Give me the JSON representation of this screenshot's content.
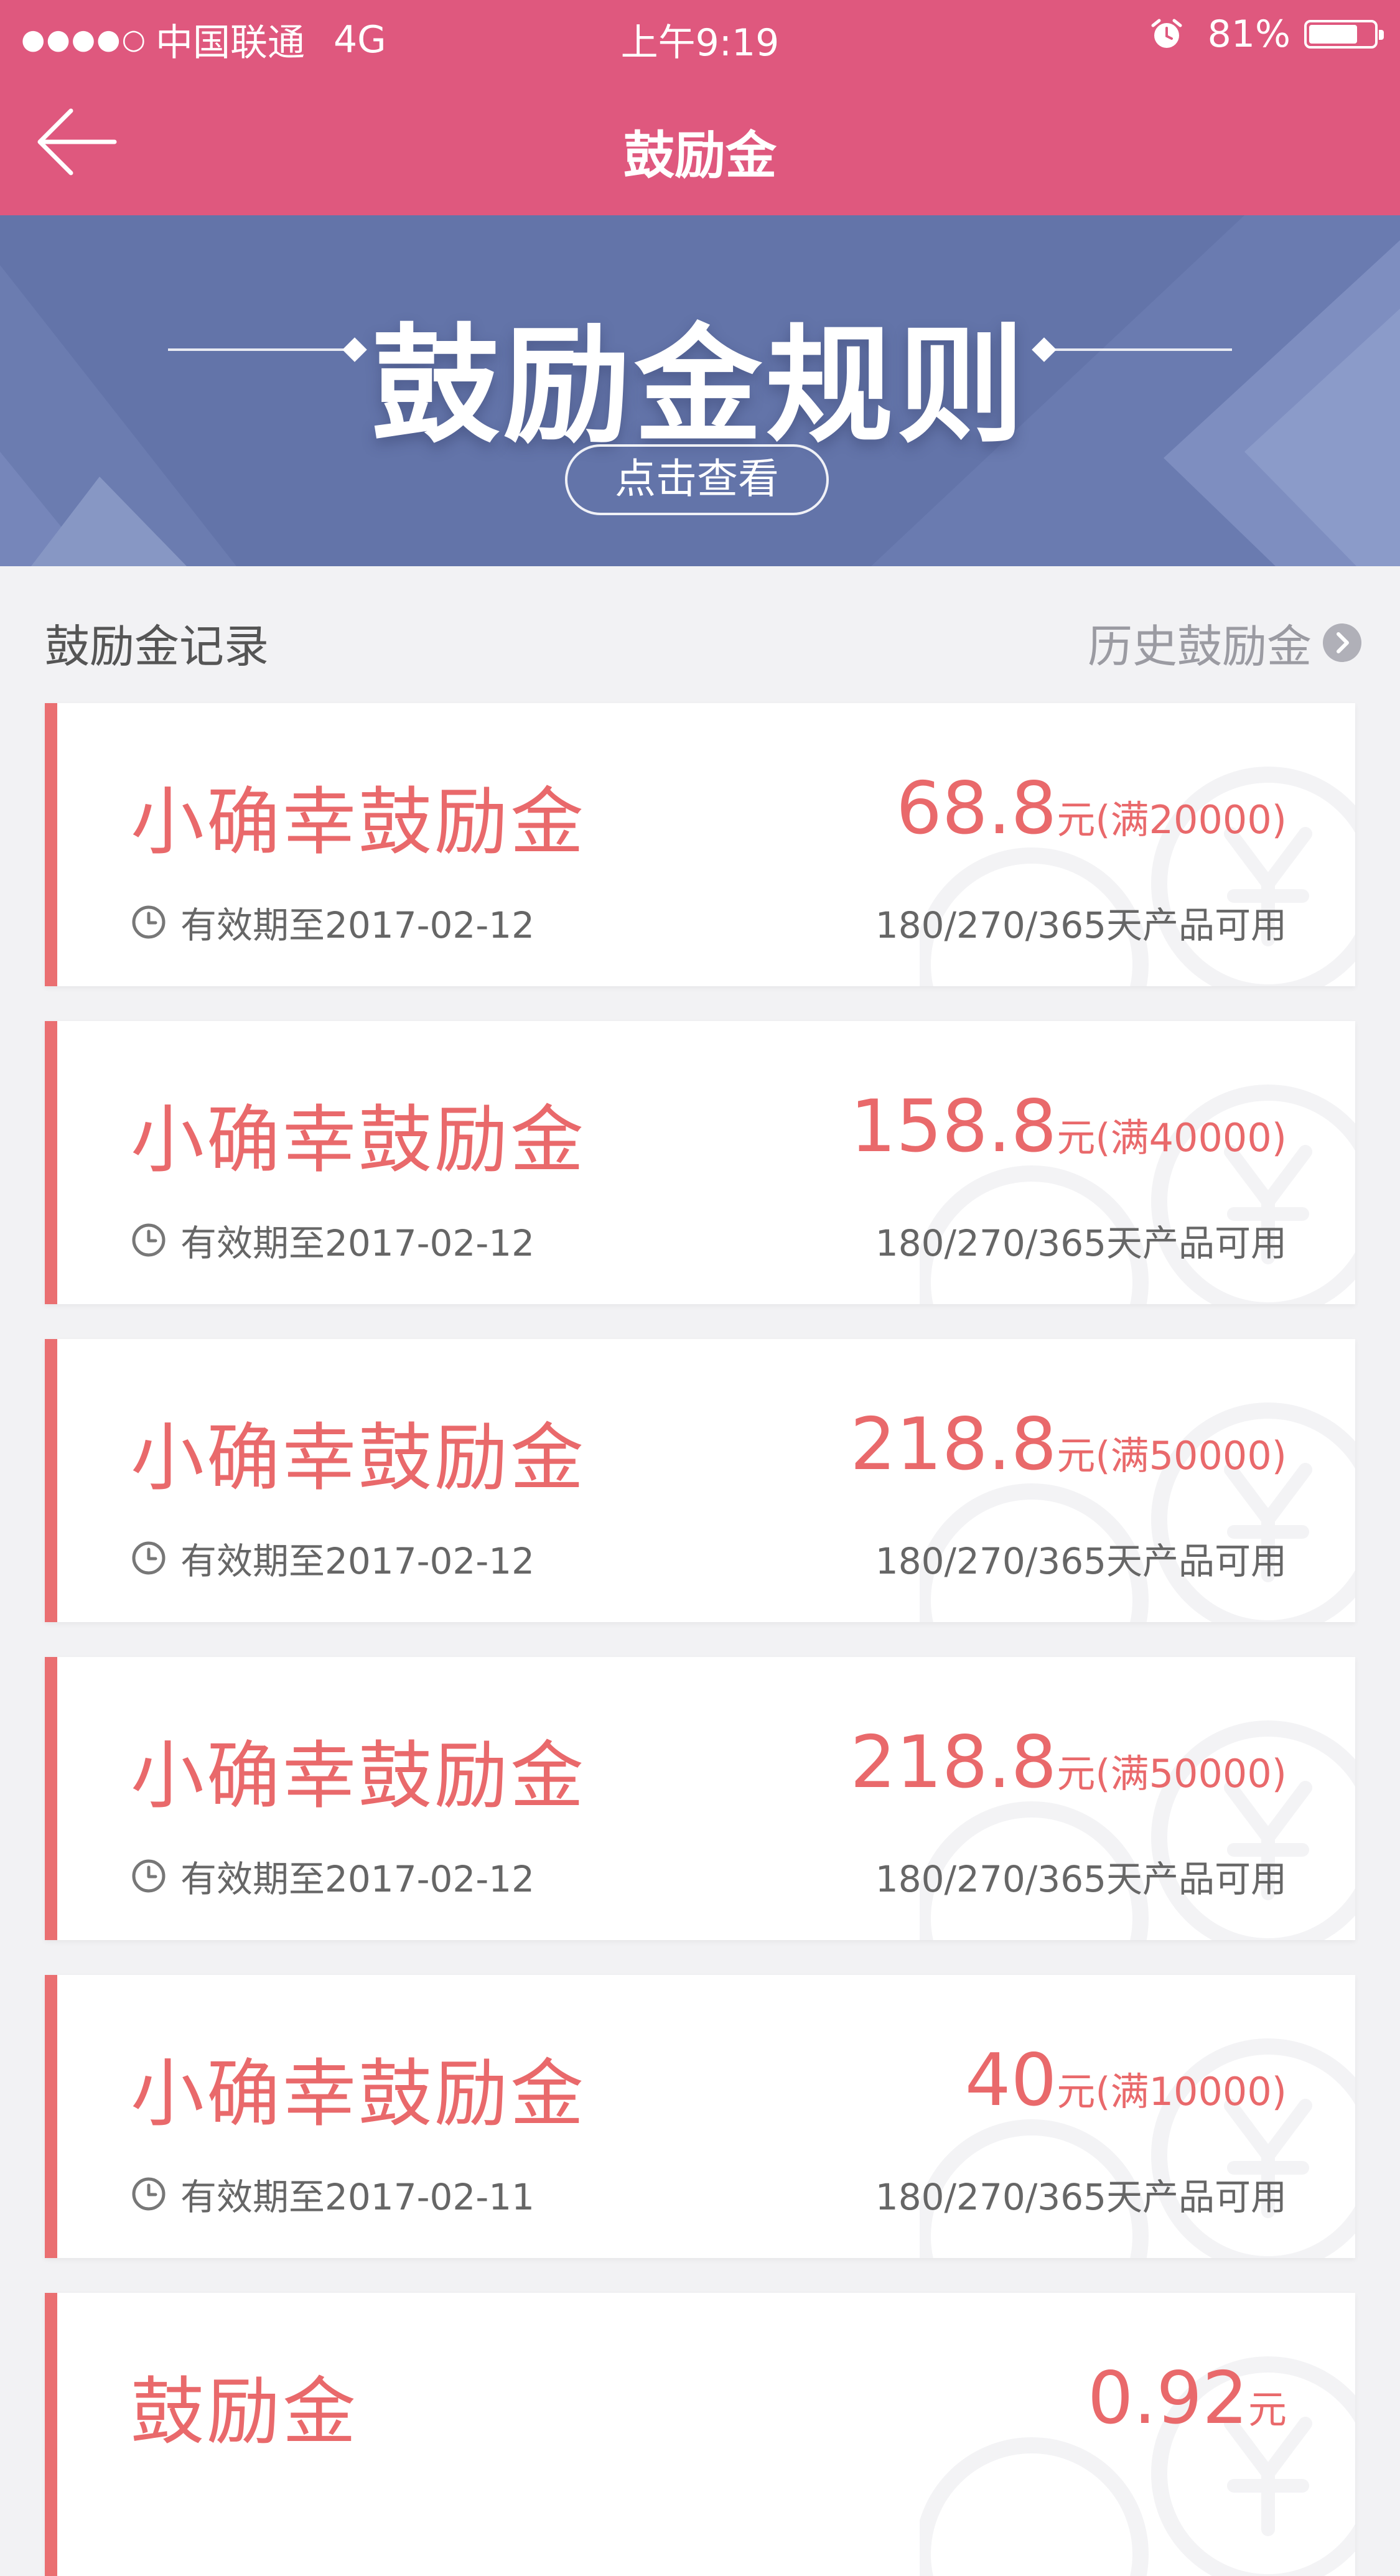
{
  "status_bar": {
    "signal": "●●●●○",
    "carrier": "中国联通",
    "network": "4G",
    "time": "上午9:19",
    "battery_percent": "81%",
    "battery_level": 0.81
  },
  "nav": {
    "title": "鼓励金"
  },
  "banner": {
    "title": "鼓励金规则",
    "button_label": "点击查看"
  },
  "section": {
    "title": "鼓励金记录",
    "history_link": "历史鼓励金"
  },
  "cards": [
    {
      "name": "小确幸鼓励金",
      "amount": "68.8",
      "unit": "元",
      "condition": "(满20000)",
      "expiry": "有效期至2017-02-12",
      "availability": "180/270/365天产品可用"
    },
    {
      "name": "小确幸鼓励金",
      "amount": "158.8",
      "unit": "元",
      "condition": "(满40000)",
      "expiry": "有效期至2017-02-12",
      "availability": "180/270/365天产品可用"
    },
    {
      "name": "小确幸鼓励金",
      "amount": "218.8",
      "unit": "元",
      "condition": "(满50000)",
      "expiry": "有效期至2017-02-12",
      "availability": "180/270/365天产品可用"
    },
    {
      "name": "小确幸鼓励金",
      "amount": "218.8",
      "unit": "元",
      "condition": "(满50000)",
      "expiry": "有效期至2017-02-12",
      "availability": "180/270/365天产品可用"
    },
    {
      "name": "小确幸鼓励金",
      "amount": "40",
      "unit": "元",
      "condition": "(满10000)",
      "expiry": "有效期至2017-02-11",
      "availability": "180/270/365天产品可用"
    },
    {
      "name": "鼓励金",
      "amount": "0.92",
      "unit": "元",
      "condition": "",
      "expiry": "",
      "availability": ""
    }
  ],
  "colors": {
    "header_pink": "#df587e",
    "banner_blue": "#6374a9",
    "card_accent": "#e9696b",
    "page_bg": "#f2f2f4"
  },
  "icons": {
    "back": "back-arrow-icon",
    "alarm": "alarm-clock-icon",
    "battery": "battery-icon",
    "history": "chevron-right-icon",
    "expiry": "clock-icon",
    "watermark": "yen-coin-watermark-icon"
  }
}
